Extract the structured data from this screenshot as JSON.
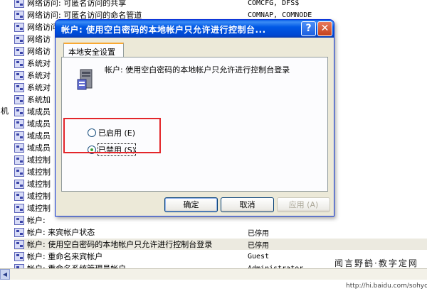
{
  "background": {
    "gutter_text": "机",
    "rows": [
      {
        "name": "网络访问: 可匿名访问的共享",
        "setting": "COMCFG, DFS$"
      },
      {
        "name": "网络访问: 可匿名访问的命名管道",
        "setting": "COMNAP, COMNODE"
      },
      {
        "name": "网络访问",
        "setting": ""
      },
      {
        "name": "网络访",
        "setting": ""
      },
      {
        "name": "网络访",
        "setting": ""
      },
      {
        "name": "系统对",
        "setting": ""
      },
      {
        "name": "系统对",
        "setting": ""
      },
      {
        "name": "系统对",
        "setting": ""
      },
      {
        "name": "系统加",
        "setting": ""
      },
      {
        "name": "域成员",
        "setting": ""
      },
      {
        "name": "域成员",
        "setting": ""
      },
      {
        "name": "域成员",
        "setting": ""
      },
      {
        "name": "域成员",
        "setting": ""
      },
      {
        "name": "域控制",
        "setting": ""
      },
      {
        "name": "域控制",
        "setting": ""
      },
      {
        "name": "域控制",
        "setting": ""
      },
      {
        "name": "域控制",
        "setting": ""
      },
      {
        "name": "域控制",
        "setting": ""
      },
      {
        "name": "帐户:",
        "setting": ""
      },
      {
        "name": "帐户: 来宾帐户状态",
        "setting": "已停用"
      },
      {
        "name": "帐户: 使用空白密码的本地帐户只允许进行控制台登录",
        "setting": "已停用"
      },
      {
        "name": "帐户: 重命名来宾帐户",
        "setting": "Guest"
      },
      {
        "name": "帐户: 重命名系统管理员帐户",
        "setting": "Administrator"
      }
    ],
    "watermark_line1": "闻言野鹤·教字定网",
    "watermark_url": "http://hi.baidu.com/sohyo"
  },
  "dialog": {
    "title": "帐户: 使用空白密码的本地帐户只允许进行控制台...",
    "help_label": "?",
    "close_label": "✕",
    "tab_label": "本地安全设置",
    "policy_text": "帐户: 使用空白密码的本地帐户只允许进行控制台登录",
    "options": [
      {
        "label": "已启用 (E)",
        "checked": false
      },
      {
        "label": "已禁用 (S)",
        "checked": true
      }
    ],
    "buttons": {
      "ok": "确定",
      "cancel": "取消",
      "apply": "应用 (A)"
    }
  },
  "colors": {
    "title_blue": "#0054e3",
    "highlight_box": "#e3262a",
    "dialog_face": "#ece9d8"
  }
}
